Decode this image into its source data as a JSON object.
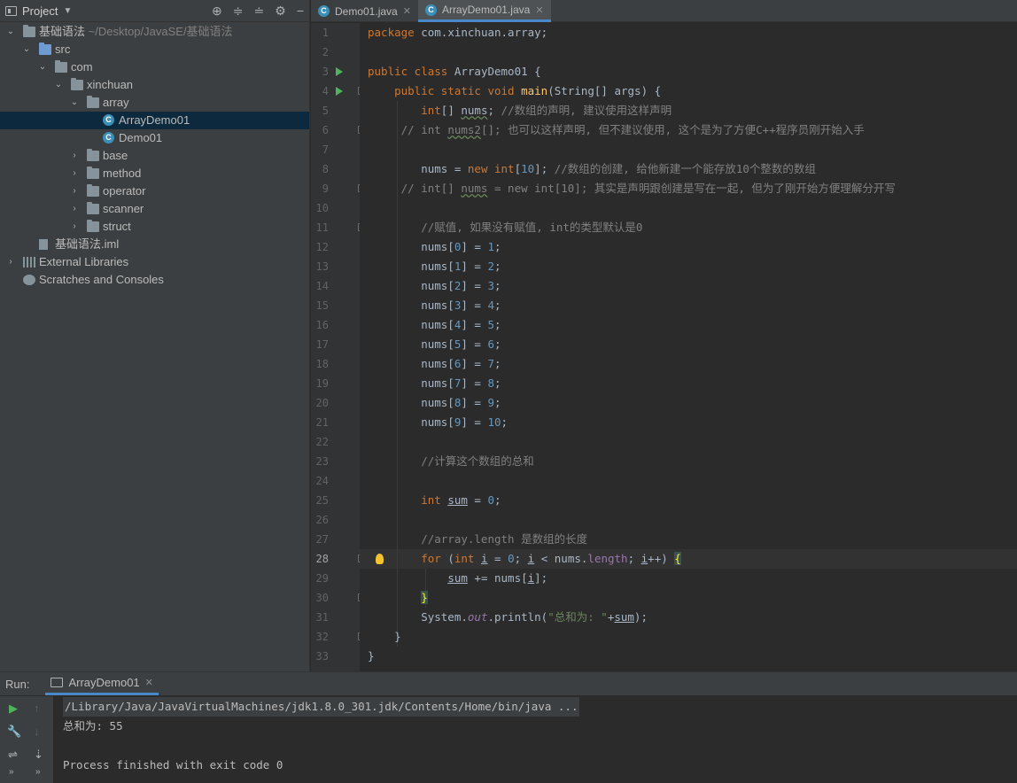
{
  "project": {
    "title": "Project",
    "root": {
      "name": "基础语法",
      "path": "~/Desktop/JavaSE/基础语法"
    },
    "tree": [
      {
        "label": "src",
        "level": 1,
        "expanded": true,
        "type": "folder-blue"
      },
      {
        "label": "com",
        "level": 2,
        "expanded": true,
        "type": "folder"
      },
      {
        "label": "xinchuan",
        "level": 3,
        "expanded": true,
        "type": "folder"
      },
      {
        "label": "array",
        "level": 4,
        "expanded": true,
        "type": "folder"
      },
      {
        "label": "ArrayDemo01",
        "level": 5,
        "type": "class",
        "selected": true
      },
      {
        "label": "Demo01",
        "level": 5,
        "type": "class"
      },
      {
        "label": "base",
        "level": 4,
        "expanded": false,
        "type": "folder"
      },
      {
        "label": "method",
        "level": 4,
        "expanded": false,
        "type": "folder"
      },
      {
        "label": "operator",
        "level": 4,
        "expanded": false,
        "type": "folder"
      },
      {
        "label": "scanner",
        "level": 4,
        "expanded": false,
        "type": "folder"
      },
      {
        "label": "struct",
        "level": 4,
        "expanded": false,
        "type": "folder"
      },
      {
        "label": "基础语法.iml",
        "level": 1,
        "type": "iml"
      },
      {
        "label": "External Libraries",
        "level": 0,
        "expanded": false,
        "type": "lib"
      },
      {
        "label": "Scratches and Consoles",
        "level": 0,
        "type": "scratch"
      }
    ]
  },
  "tabs": [
    {
      "label": "Demo01.java",
      "active": false
    },
    {
      "label": "ArrayDemo01.java",
      "active": true
    }
  ],
  "editor": {
    "current_line": 28,
    "line_numbers": [
      "1",
      "2",
      "3",
      "4",
      "5",
      "6",
      "7",
      "8",
      "9",
      "10",
      "11",
      "12",
      "13",
      "14",
      "15",
      "16",
      "17",
      "18",
      "19",
      "20",
      "21",
      "22",
      "23",
      "24",
      "25",
      "26",
      "27",
      "28",
      "29",
      "30",
      "31",
      "32",
      "33"
    ]
  },
  "run": {
    "label": "Run:",
    "tab": "ArrayDemo01",
    "output": [
      "/Library/Java/JavaVirtualMachines/jdk1.8.0_301.jdk/Contents/Home/bin/java ...",
      "总和为: 55",
      "",
      "Process finished with exit code 0"
    ]
  },
  "colors": {
    "keyword": "#cc7832",
    "number": "#6897bb",
    "comment": "#808080",
    "string": "#6a8759",
    "field": "#9876aa",
    "method": "#ffc66d",
    "selection": "#0d293e",
    "accent": "#4a88c7"
  }
}
